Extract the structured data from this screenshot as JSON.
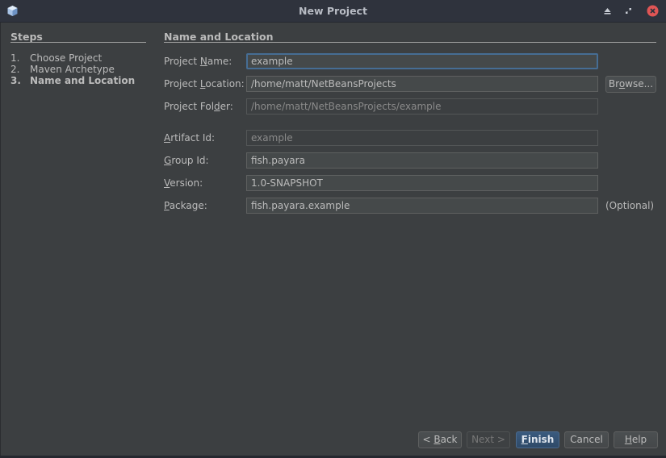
{
  "window": {
    "title": "New Project",
    "controls": [
      "eject-icon",
      "restore-icon",
      "close-icon"
    ],
    "close_color": "#e05555"
  },
  "steps": {
    "title": "Steps",
    "items": [
      {
        "num": "1.",
        "label": "Choose Project",
        "active": false
      },
      {
        "num": "2.",
        "label": "Maven Archetype",
        "active": false
      },
      {
        "num": "3.",
        "label": "Name and Location",
        "active": true
      }
    ]
  },
  "form": {
    "section_title": "Name and Location",
    "project_name": {
      "label_pre": "Project ",
      "mnemonic": "N",
      "label_post": "ame:",
      "value": "example"
    },
    "project_location": {
      "label_pre": "Project ",
      "mnemonic": "L",
      "label_post": "ocation:",
      "value": "/home/matt/NetBeansProjects"
    },
    "project_folder": {
      "label_pre": "Project Fol",
      "mnemonic": "d",
      "label_post": "er:",
      "value": "/home/matt/NetBeansProjects/example"
    },
    "artifact_id": {
      "label_pre": "",
      "mnemonic": "A",
      "label_post": "rtifact Id:",
      "value": "example"
    },
    "group_id": {
      "label_pre": "",
      "mnemonic": "G",
      "label_post": "roup Id:",
      "value": "fish.payara"
    },
    "version": {
      "label_pre": "",
      "mnemonic": "V",
      "label_post": "ersion:",
      "value": "1.0-SNAPSHOT"
    },
    "package": {
      "label_pre": "",
      "mnemonic": "P",
      "label_post": "ackage:",
      "value": "fish.payara.example",
      "hint": "(Optional)"
    },
    "browse": {
      "pre": "Br",
      "mnemonic": "o",
      "post": "wse..."
    }
  },
  "buttons": {
    "back": {
      "pre": "< ",
      "mnemonic": "B",
      "post": "ack"
    },
    "next": {
      "label": "Next >"
    },
    "finish": {
      "pre": "",
      "mnemonic": "F",
      "post": "inish"
    },
    "cancel": {
      "label": "Cancel"
    },
    "help": {
      "pre": "",
      "mnemonic": "H",
      "post": "elp"
    }
  },
  "colors": {
    "background": "#3c3f41",
    "titlebar": "#2f333d",
    "focus_border": "#466d94",
    "default_button": "#2f4a68"
  }
}
